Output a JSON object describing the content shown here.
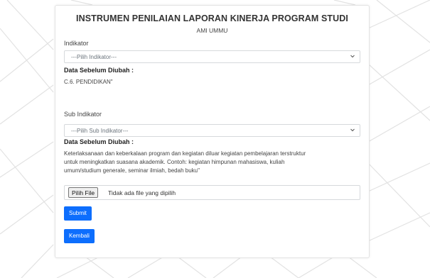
{
  "page": {
    "title": "INSTRUMEN PENILAIAN LAPORAN KINERJA PROGRAM STUDI",
    "subtitle": "AMI UMMU"
  },
  "form": {
    "indikator": {
      "label": "Indikator",
      "selected": "---Pilih Indikator---",
      "previous_label": "Data Sebelum Diubah :",
      "previous_value": "C.6. PENDIDIKAN\""
    },
    "sub_indikator": {
      "label": "Sub Indikator",
      "selected": "---Pilih Sub Indikator---",
      "previous_label": "Data Sebelum Diubah :",
      "previous_value_line1": "Keterlaksanaan dan keberkalaan program dan kegiatan diluar kegiatan pembelajaran terstruktur",
      "previous_value_line2": "untuk meningkatkan suasana akademik. Contoh: kegiatan himpunan mahasiswa, kuliah",
      "previous_value_line3": "umum/studium generale, seminar ilmiah, bedah buku\""
    },
    "file": {
      "button_label": "Pilih File",
      "status": "Tidak ada file yang dipilih"
    },
    "submit_label": "Submit",
    "back_label": "Kembali"
  },
  "colors": {
    "primary": "#0d6efd",
    "background": "#ffffff",
    "border": "#d6d9dc"
  },
  "icons": {
    "select_caret": "chevron-down-icon"
  }
}
